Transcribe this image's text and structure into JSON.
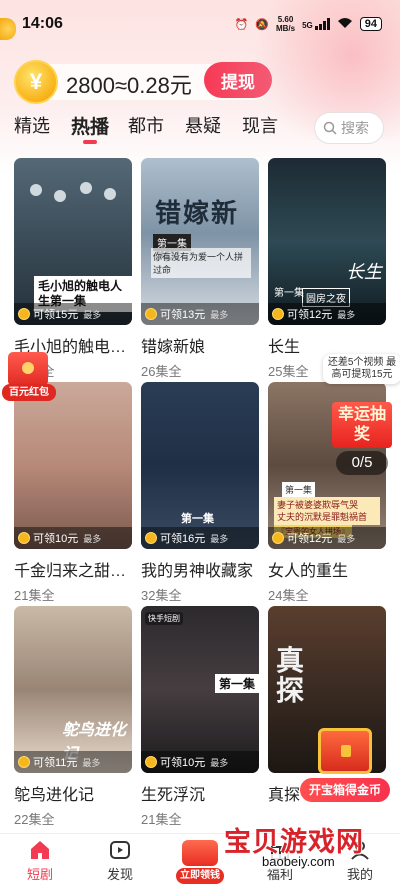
{
  "status_bar": {
    "time": "14:06",
    "net_speed_top": "5.60",
    "net_speed_bottom": "MB/s",
    "network": "5G",
    "battery": "94"
  },
  "coins": {
    "icon_char": "¥",
    "balance_text": "2800≈0.28元",
    "withdraw_label": "提现"
  },
  "tabs": [
    {
      "label": "精选",
      "active": false
    },
    {
      "label": "热播",
      "active": true
    },
    {
      "label": "都市",
      "active": false
    },
    {
      "label": "悬疑",
      "active": false
    },
    {
      "label": "现言",
      "active": false
    }
  ],
  "search": {
    "placeholder": "搜索"
  },
  "reward_most": "最多",
  "dramas": [
    {
      "title": "毛小旭的触电…",
      "episodes": "21集全",
      "reward": "可领15元",
      "poster_caption": "毛小旭的触电人生第一集"
    },
    {
      "title": "错嫁新娘",
      "episodes": "26集全",
      "reward": "可领13元",
      "poster_title": "错嫁新娘",
      "poster_ep": "第一集",
      "poster_sub": "你有没有为爱一个人拼过命"
    },
    {
      "title": "长生",
      "episodes": "25集全",
      "reward": "可领12元",
      "poster_ep": "第一集",
      "poster_box": "圆房之夜",
      "poster_side": "长生"
    },
    {
      "title": "千金归来之甜…",
      "episodes": "21集全",
      "reward": "可领10元"
    },
    {
      "title": "我的男神收藏家",
      "episodes": "32集全",
      "reward": "可领16元",
      "poster_ep": "第一集"
    },
    {
      "title": "女人的重生",
      "episodes": "24集全",
      "reward": "可领12元",
      "poster_ep": "第一集",
      "poster_note": "妻子被婆婆欺辱气哭",
      "poster_note2": "丈夫的沉默是罪魁祸首",
      "poster_note3": "『宝贵的女人拼场』"
    },
    {
      "title": "鸵鸟进化记",
      "episodes": "22集全",
      "reward": "可领11元",
      "poster_title": "鸵鸟进化记"
    },
    {
      "title": "生死浮沉",
      "episodes": "21集全",
      "reward": "可领10元",
      "poster_brand": "快手短剧",
      "poster_ep": "第一集"
    },
    {
      "title": "真探",
      "episodes": "",
      "reward": "",
      "poster_title": "真探"
    }
  ],
  "hongbao": {
    "label": "百元红包"
  },
  "lottery": {
    "tip": "还差5个视频 最高可提现15元",
    "title": "幸运抽奖",
    "count": "0/5"
  },
  "treasure": {
    "label": "开宝箱得金币"
  },
  "watermark": {
    "title": "宝贝游戏网",
    "url": "baobeiy.com"
  },
  "bottom_nav": [
    {
      "label": "短剧",
      "icon": "home-icon",
      "active": true
    },
    {
      "label": "发现",
      "icon": "play-icon",
      "active": false
    },
    {
      "label": "立即领钱",
      "icon": "money-bag-icon",
      "active": false
    },
    {
      "label": "福利",
      "icon": "gift-icon",
      "active": false
    },
    {
      "label": "我的",
      "icon": "user-icon",
      "active": false
    }
  ],
  "colors": {
    "accent": "#f23b52",
    "coin": "#f8b21a"
  }
}
